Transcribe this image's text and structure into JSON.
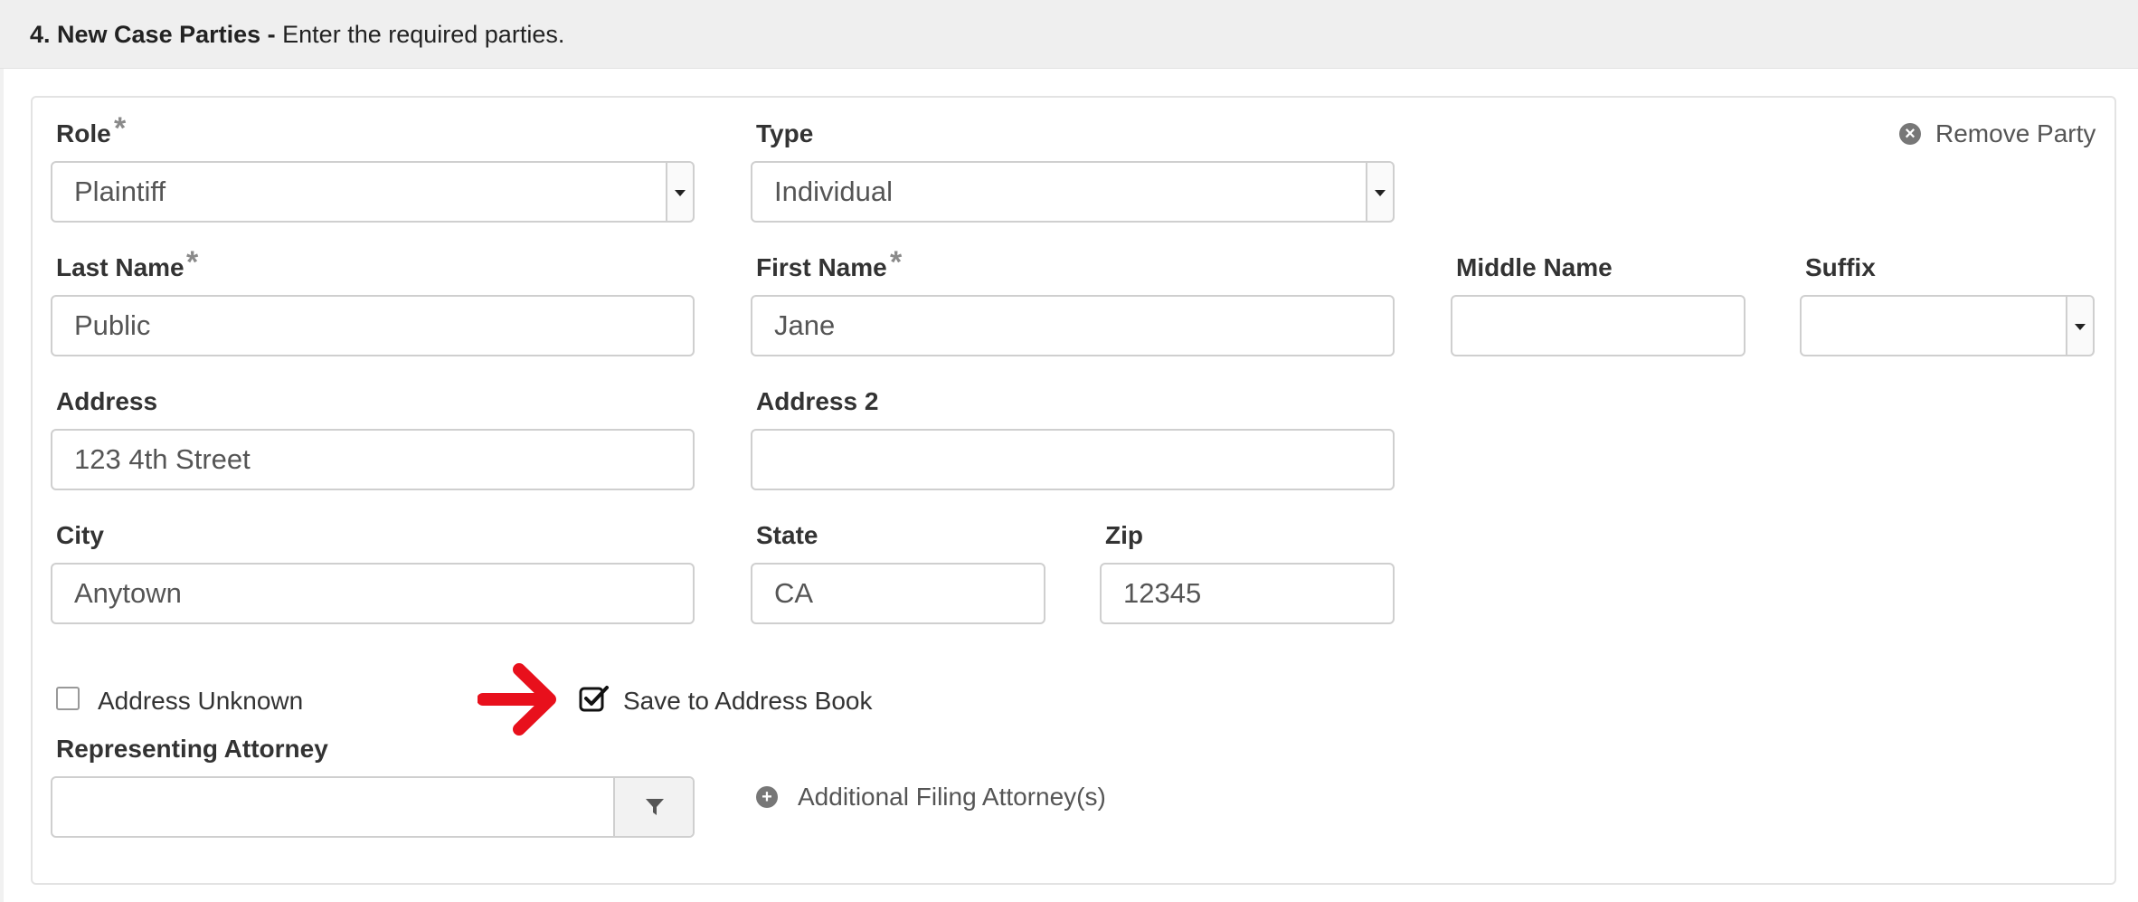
{
  "header": {
    "step": "4. New Case Parties -",
    "instruction": "Enter the required parties."
  },
  "party": {
    "remove_label": "Remove Party",
    "role": {
      "label": "Role",
      "value": "Plaintiff"
    },
    "type": {
      "label": "Type",
      "value": "Individual"
    },
    "last_name": {
      "label": "Last Name",
      "value": "Public"
    },
    "first_name": {
      "label": "First Name",
      "value": "Jane"
    },
    "middle_name": {
      "label": "Middle Name",
      "value": ""
    },
    "suffix": {
      "label": "Suffix",
      "value": ""
    },
    "address": {
      "label": "Address",
      "value": "123 4th Street"
    },
    "address2": {
      "label": "Address 2",
      "value": ""
    },
    "city": {
      "label": "City",
      "value": "Anytown"
    },
    "state": {
      "label": "State",
      "value": "CA"
    },
    "zip": {
      "label": "Zip",
      "value": "12345"
    },
    "address_unknown": {
      "label": "Address Unknown",
      "checked": false
    },
    "save_to_address_book": {
      "label": "Save to Address Book",
      "checked": true
    },
    "representing_attorney": {
      "label": "Representing Attorney",
      "value": ""
    },
    "additional_attorneys_label": "Additional Filing Attorney(s)"
  },
  "required_marker": "*",
  "colors": {
    "annotation_arrow": "#e8101c"
  }
}
